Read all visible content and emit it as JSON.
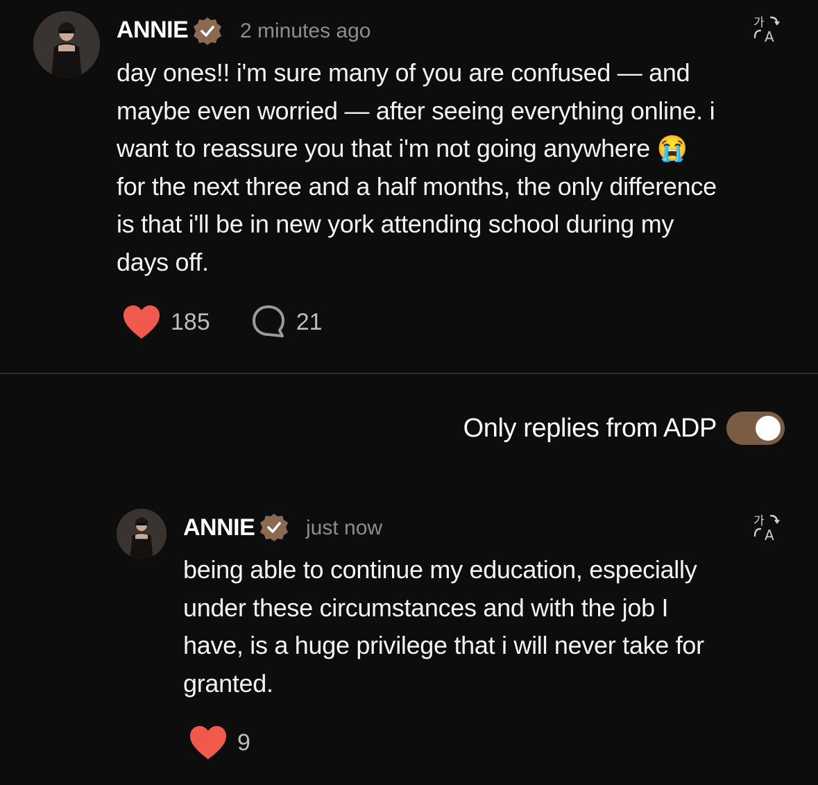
{
  "post": {
    "author": "ANNIE",
    "time": "2 minutes ago",
    "text": "day ones!! i'm sure many of you are confused — and maybe even worried — after seeing everything online. i want to reassure you that i'm not going anywhere 😭 for the next three and a half months, the only difference is that i'll be in new york attending school during my days off.",
    "likes": "185",
    "comments": "21"
  },
  "filter": {
    "label": "Only replies from ADP",
    "enabled": true
  },
  "reply": {
    "author": "ANNIE",
    "time": "just now",
    "text": "being able to continue my education, especially under these circumstances and with the job I have, is a huge privilege that i will never take for granted.",
    "likes": "9"
  },
  "icons": {
    "translate": "translate-icon",
    "heart": "heart-icon",
    "comment": "comment-bubble-icon",
    "verified": "verified-badge-icon"
  },
  "colors": {
    "background": "#0e0d0d",
    "heart": "#ef5a4c",
    "badge": "#8a6a52",
    "toggle": "#7a5c45"
  }
}
